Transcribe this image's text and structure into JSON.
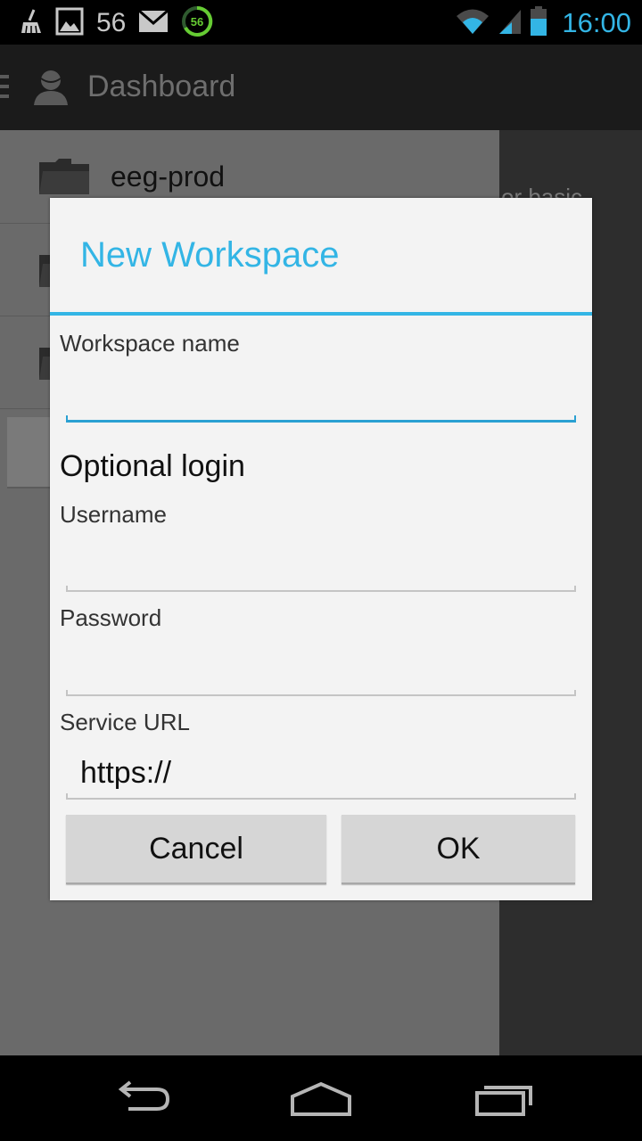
{
  "status_bar": {
    "notification_count": "56",
    "time": "16:00",
    "icons": [
      "cleaner-broom-icon",
      "image-icon",
      "mail-icon",
      "download-progress-icon",
      "wifi-icon",
      "signal-icon",
      "battery-icon"
    ],
    "accent_color": "#33b5e5"
  },
  "action_bar": {
    "title": "Dashboard",
    "icons": [
      "drawer-menu-icon",
      "profile-icon"
    ]
  },
  "background": {
    "drawer_items": [
      {
        "label": "eeg-prod",
        "icon": "folder-icon"
      },
      {
        "label": "",
        "icon": "folder-icon"
      },
      {
        "label": "",
        "icon": "folder-icon"
      }
    ],
    "peek_text": "or basic"
  },
  "dialog": {
    "title": "New Workspace",
    "title_color": "#33b5e5",
    "fields": {
      "workspace_name": {
        "label": "Workspace name",
        "value": ""
      },
      "section_heading": "Optional login",
      "username": {
        "label": "Username",
        "value": ""
      },
      "password": {
        "label": "Password",
        "value": ""
      },
      "service_url": {
        "label": "Service URL",
        "value": "https://"
      }
    },
    "buttons": {
      "cancel": "Cancel",
      "ok": "OK"
    }
  },
  "nav_bar": {
    "icons": [
      "back-icon",
      "home-icon",
      "recent-apps-icon"
    ]
  }
}
